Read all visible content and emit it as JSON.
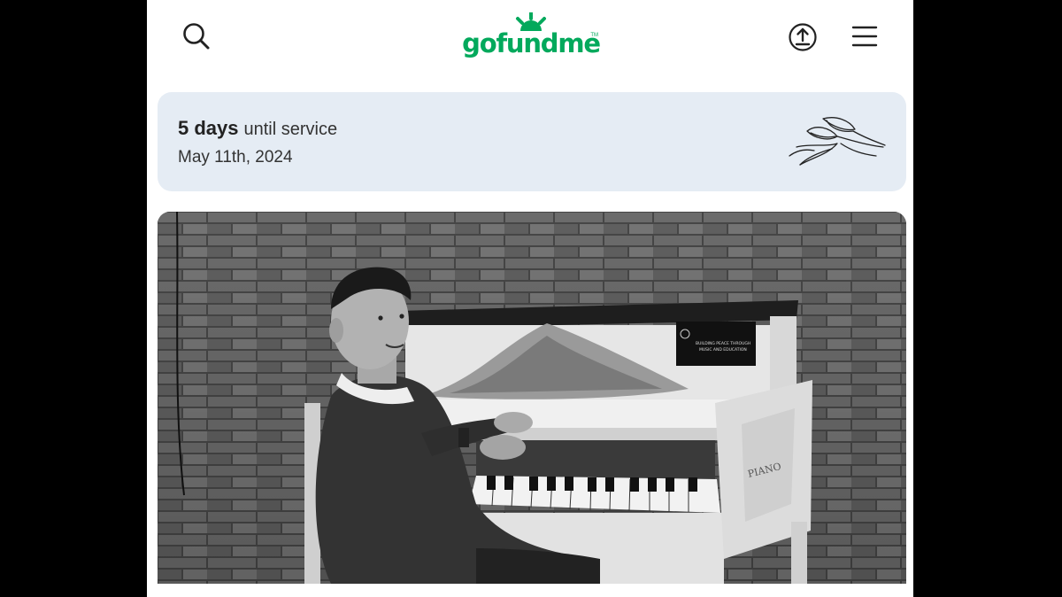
{
  "header": {
    "logo_text": "gofundme",
    "logo_tm": "TM",
    "icons": [
      "search-icon",
      "share-icon",
      "menu-icon"
    ]
  },
  "service": {
    "days": "5 days",
    "until": "until service",
    "date": "May 11th, 2024"
  },
  "photo": {
    "sign_text": [
      "BUILDING PEACE THROUGH",
      "MUSIC AND EDUCATION"
    ],
    "piano_side_text": "PIANO"
  },
  "colors": {
    "brand_green": "#02a95c",
    "banner_bg": "#e5ecf4",
    "outer_bg": "#000000"
  }
}
